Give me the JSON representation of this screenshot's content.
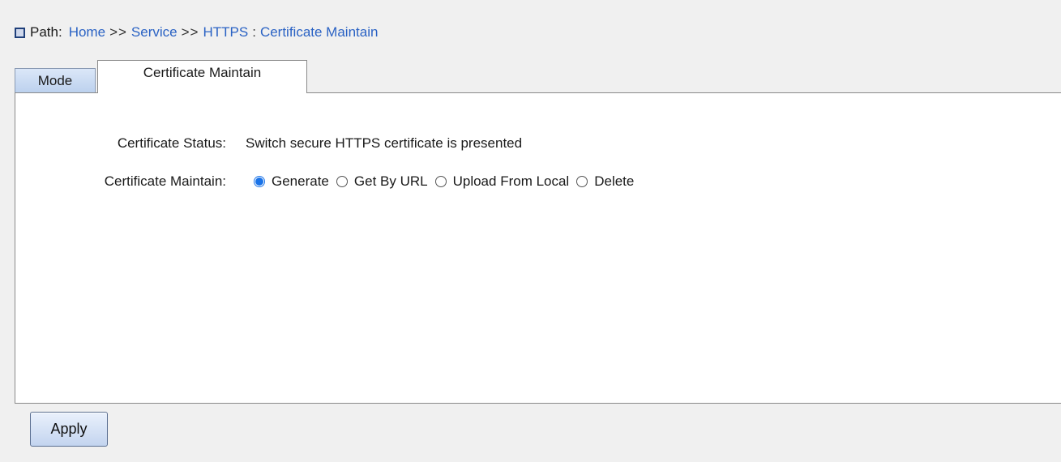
{
  "breadcrumb": {
    "prefix": "Path:",
    "items": [
      "Home",
      "Service",
      "HTTPS",
      "Certificate Maintain"
    ],
    "separator": ">>",
    "final_separator": ":"
  },
  "tabs": [
    {
      "label": "Mode",
      "active": false
    },
    {
      "label": "Certificate Maintain",
      "active": true
    }
  ],
  "form": {
    "status_label": "Certificate Status:",
    "status_value": "Switch secure HTTPS certificate is presented",
    "maintain_label": "Certificate Maintain:",
    "options": [
      {
        "label": "Generate",
        "checked": true
      },
      {
        "label": "Get By URL",
        "checked": false
      },
      {
        "label": "Upload From Local",
        "checked": false
      },
      {
        "label": "Delete",
        "checked": false
      }
    ]
  },
  "apply_label": "Apply",
  "colors": {
    "link": "#2a62c4",
    "radio_accent": "#1a73e8",
    "background": "#f0f0f0"
  }
}
